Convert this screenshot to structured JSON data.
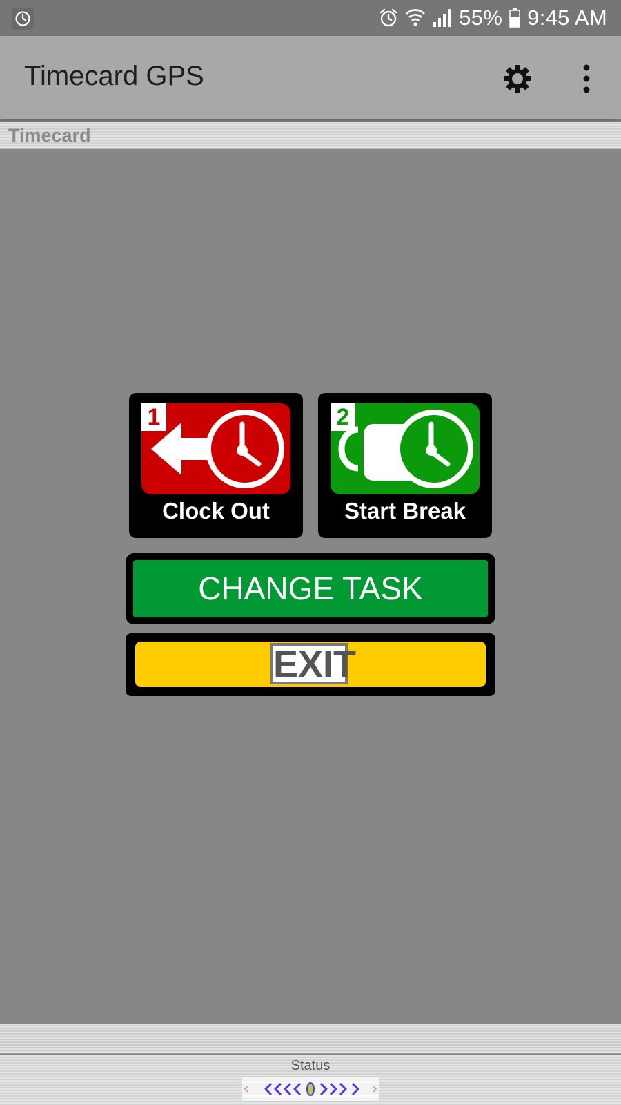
{
  "status_bar": {
    "battery": "55%",
    "time": "9:45 AM",
    "icons": [
      "clock-icon",
      "alarm-icon",
      "wifi-icon",
      "signal-icon",
      "battery-icon"
    ]
  },
  "app_bar": {
    "title": "Timecard GPS",
    "icons": [
      "settings-icon",
      "more-vertical-icon"
    ]
  },
  "section": {
    "title": "Timecard"
  },
  "actions": {
    "clock_out": {
      "number": "1",
      "label": "Clock Out",
      "color": "#cc0000",
      "icon": "clock-out-arrow-icon"
    },
    "start_break": {
      "number": "2",
      "label": "Start Break",
      "color": "#0b9a0b",
      "icon": "coffee-cup-clock-icon"
    },
    "change_task": {
      "label": "CHANGE TASK",
      "color": "#009933"
    },
    "exit": {
      "label": "EXIT",
      "color": "#ffcc00"
    }
  },
  "footer": {
    "status_label": "Status"
  }
}
